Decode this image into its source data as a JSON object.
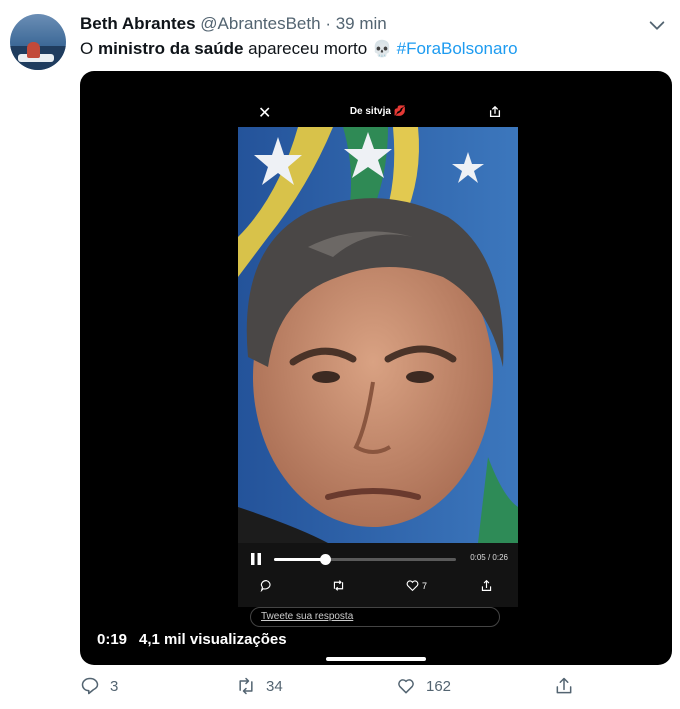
{
  "tweet": {
    "author_name": "Beth Abrantes",
    "handle": "@AbrantesBeth",
    "separator": "·",
    "time": "39 min",
    "text_parts": {
      "p1": "O ",
      "b1": "ministro da saúde",
      "p2": " apareceu morto ",
      "emoji": "💀",
      "hashtag": "#ForaBolsonaro"
    }
  },
  "media": {
    "embedded": {
      "close": "✕",
      "title": "De sitvja 💋",
      "time": "0:05 / 0:26",
      "progress": 0.28,
      "likes": "7",
      "reply_prompt": "Tweete sua resposta"
    },
    "duration": "0:19",
    "views": "4,1 mil visualizações"
  },
  "actions": {
    "replies": "3",
    "retweets": "34",
    "likes": "162"
  },
  "colors": {
    "link": "#1d9bf0",
    "muted": "#536471",
    "media_bg": "#000000"
  },
  "icons": [
    "avatar",
    "chevron-down-icon",
    "close-icon",
    "share-icon",
    "pause-icon",
    "reply-icon",
    "retweet-icon",
    "like-icon"
  ]
}
